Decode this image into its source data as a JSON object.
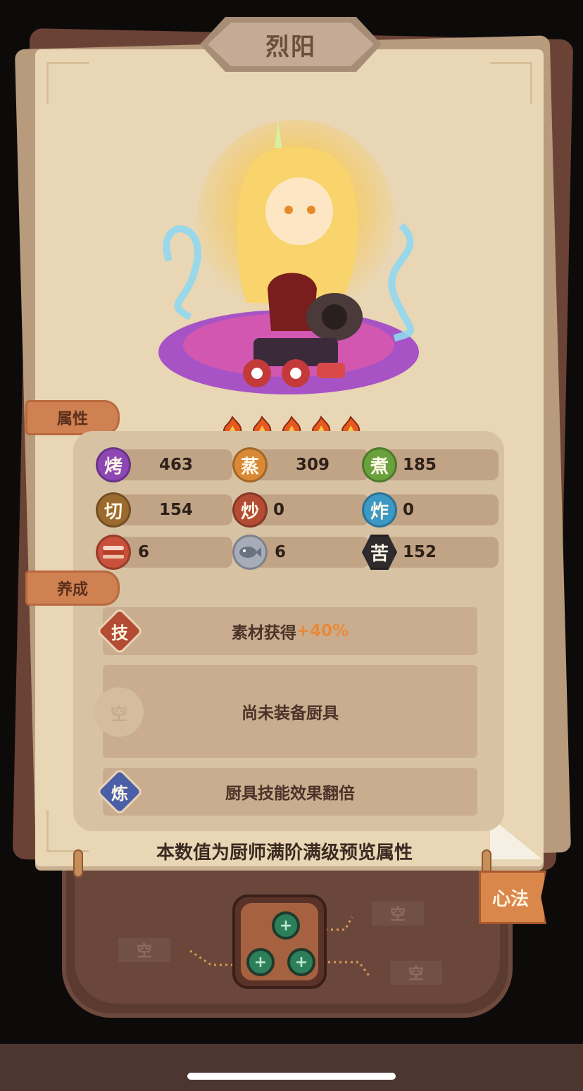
{
  "chef": {
    "name": "烈阳",
    "stars": 5
  },
  "sections": {
    "attributes": "属性",
    "cultivation": "养成"
  },
  "stats": [
    {
      "icon": "烤",
      "icon_name": "roast-icon",
      "value": "463"
    },
    {
      "icon": "蒸",
      "icon_name": "steam-icon",
      "value": "309"
    },
    {
      "icon": "煮",
      "icon_name": "boil-icon",
      "value": "185"
    },
    {
      "icon": "切",
      "icon_name": "cut-icon",
      "value": "154"
    },
    {
      "icon": "炒",
      "icon_name": "stir-fry-icon",
      "value": "0"
    },
    {
      "icon": "炸",
      "icon_name": "deep-fry-icon",
      "value": "0"
    },
    {
      "icon": "",
      "icon_name": "meat-icon",
      "value": "6"
    },
    {
      "icon": "",
      "icon_name": "fish-icon",
      "value": "6"
    },
    {
      "icon": "苦",
      "icon_name": "bitter-icon",
      "value": "152"
    }
  ],
  "skills": {
    "skill_icon": "技",
    "skill_text": "素材获得",
    "skill_bonus": "+40%",
    "equip_icon": "空",
    "equip_text": "尚未装备厨具",
    "refine_icon": "炼",
    "refine_text": "厨具技能效果翻倍"
  },
  "footnote": "本数值为厨师满阶满级预览属性",
  "xinfa": {
    "label": "心法",
    "slots": [
      "空",
      "空",
      "空"
    ]
  },
  "colors": {
    "paper": "#e9d6b4",
    "accent": "#d9874a",
    "bonus": "#e88a3a"
  }
}
